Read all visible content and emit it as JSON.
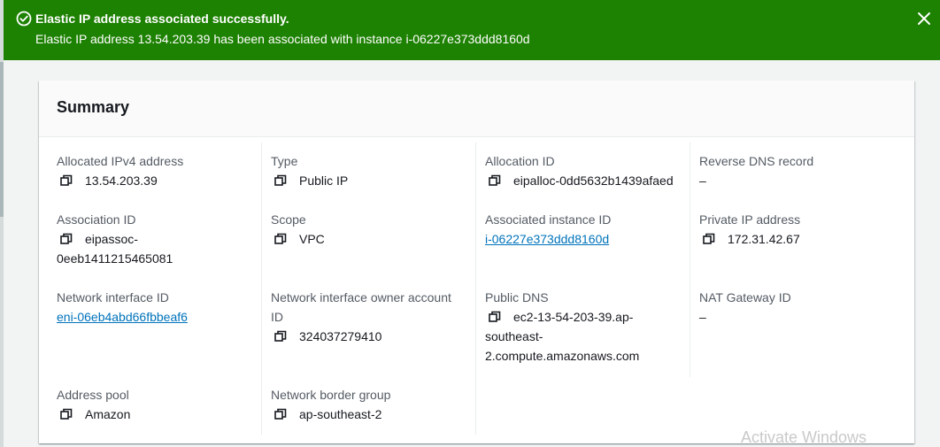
{
  "flash": {
    "title": "Elastic IP address associated successfully.",
    "message": "Elastic IP address 13.54.203.39 has been associated with instance i-06227e373ddd8160d"
  },
  "summary": {
    "title": "Summary",
    "fields": {
      "allocated_ipv4": {
        "label": "Allocated IPv4 address",
        "value": "13.54.203.39"
      },
      "type": {
        "label": "Type",
        "value": "Public IP"
      },
      "allocation_id": {
        "label": "Allocation ID",
        "value": "eipalloc-0dd5632b1439afaed"
      },
      "reverse_dns": {
        "label": "Reverse DNS record",
        "value": "–"
      },
      "association_id": {
        "label": "Association ID",
        "value_line1": "eipassoc-",
        "value_line2": "0eeb1411215465081"
      },
      "scope": {
        "label": "Scope",
        "value": "VPC"
      },
      "associated_instance": {
        "label": "Associated instance ID",
        "value": "i-06227e373ddd8160d"
      },
      "private_ip": {
        "label": "Private IP address",
        "value": "172.31.42.67"
      },
      "network_interface_id": {
        "label": "Network interface ID",
        "value": "eni-06eb4abd66fbbeaf6"
      },
      "ni_owner": {
        "label_line1": "Network interface owner account",
        "label_line2": "ID",
        "value": "324037279410"
      },
      "public_dns": {
        "label": "Public DNS",
        "value_line1": "ec2-13-54-203-39.ap-",
        "value_line2": "southeast-",
        "value_line3": "2.compute.amazonaws.com"
      },
      "nat_gateway": {
        "label": "NAT Gateway ID",
        "value": "–"
      },
      "address_pool": {
        "label": "Address pool",
        "value": "Amazon"
      },
      "border_group": {
        "label": "Network border group",
        "value": "ap-southeast-2"
      }
    }
  },
  "watermark": "Activate Windows",
  "colors": {
    "success": "#1d8102",
    "link": "#0073bb",
    "label": "#545b64"
  },
  "icons": [
    "check-circle-icon",
    "close-icon",
    "copy-icon"
  ]
}
